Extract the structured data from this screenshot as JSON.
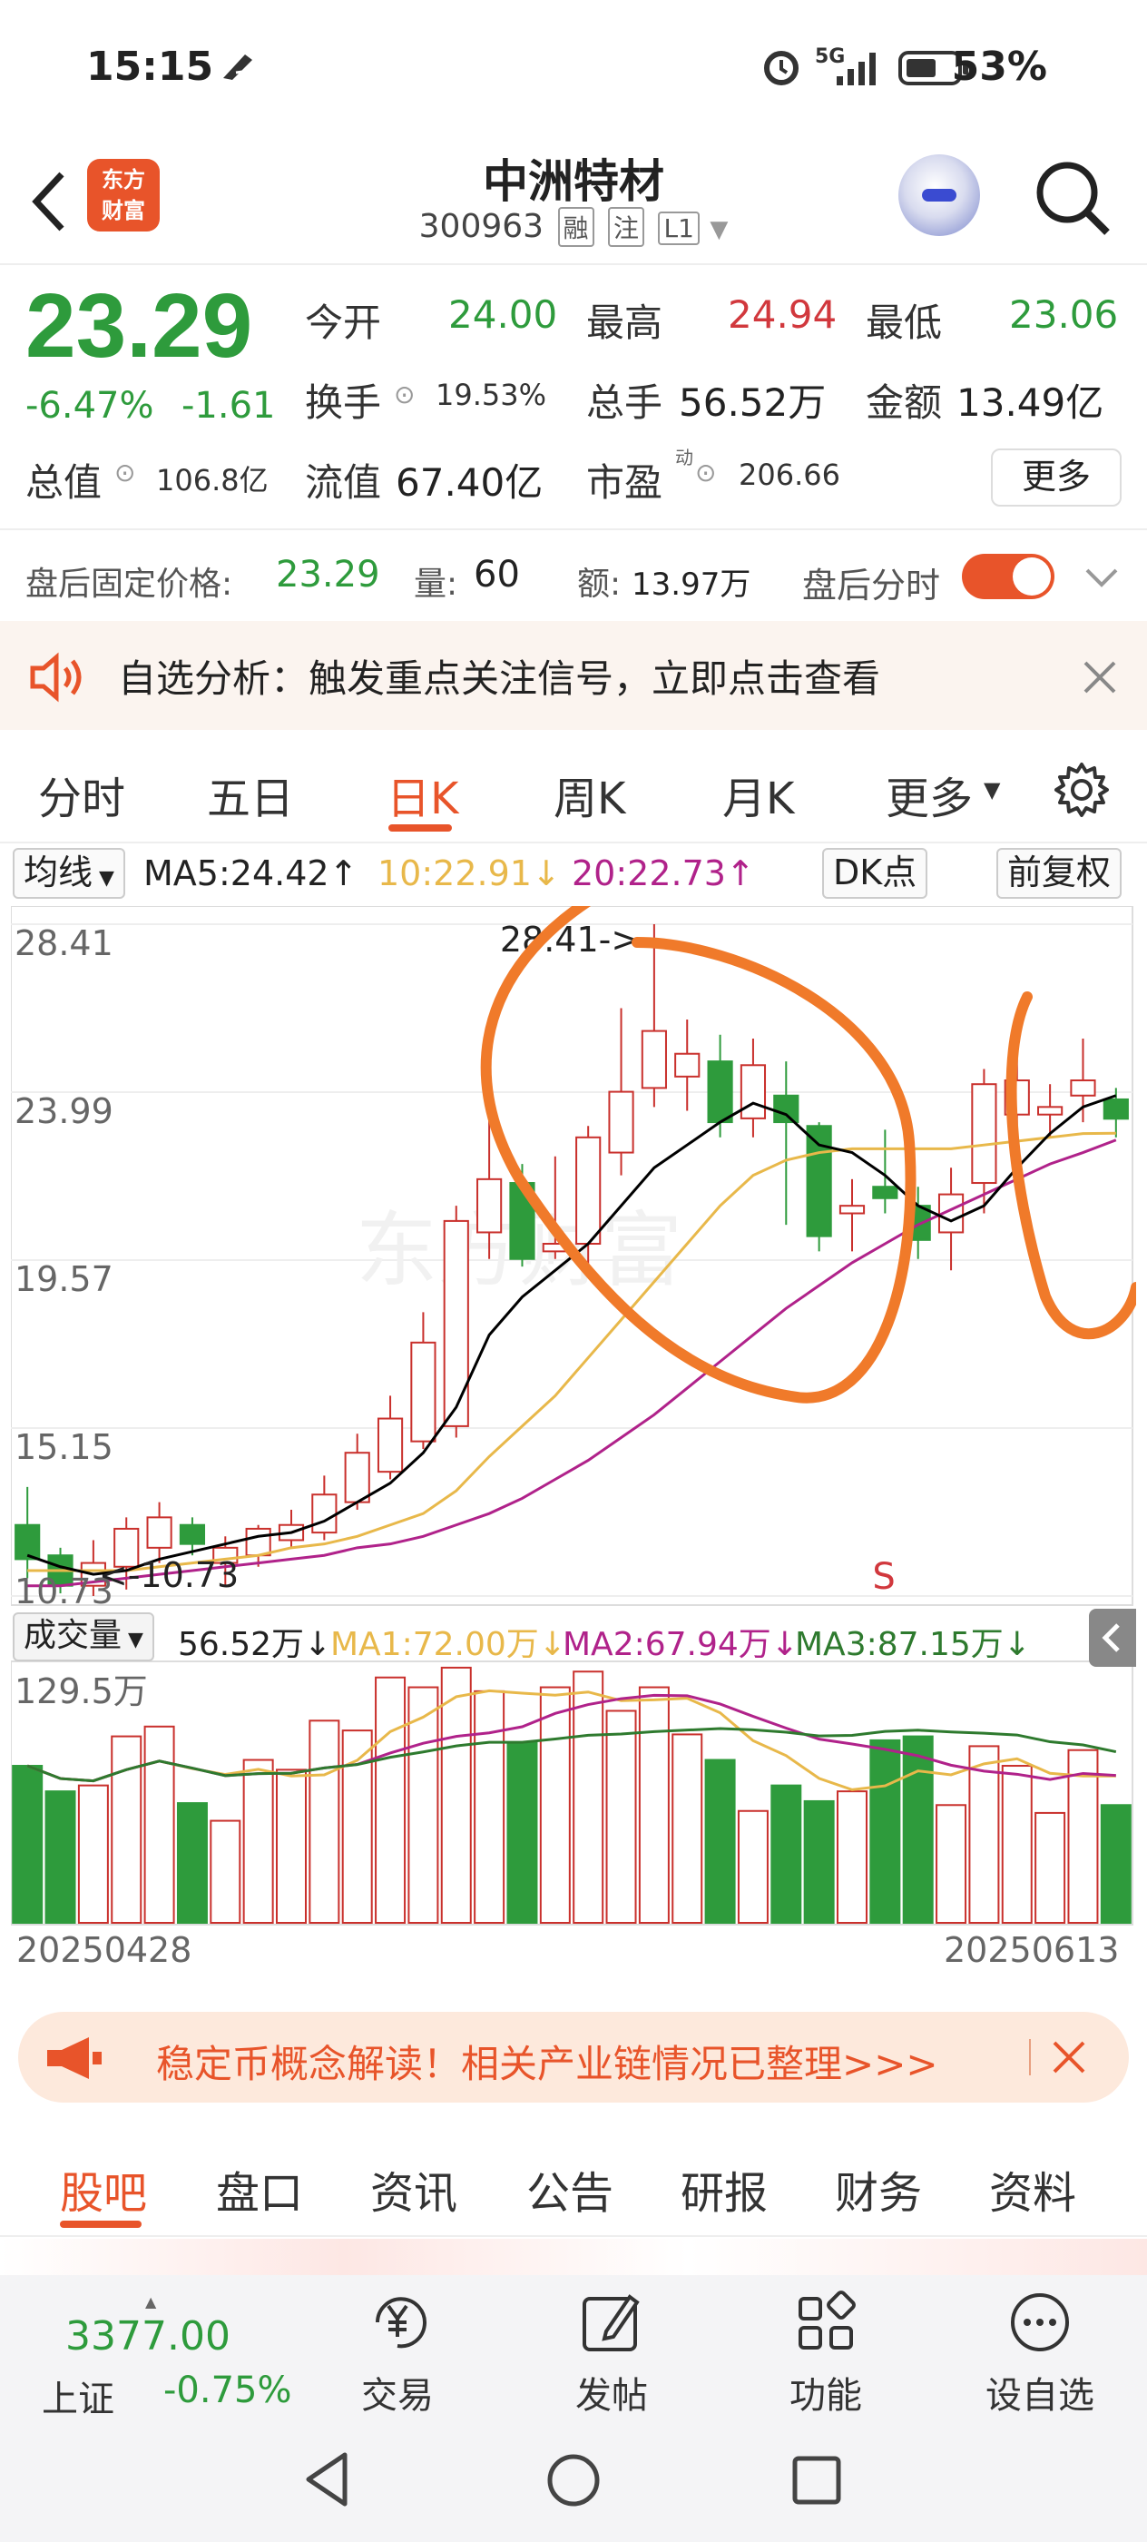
{
  "status_bar": {
    "time": "15:15",
    "network": "5G",
    "battery": "53%"
  },
  "header": {
    "app_logo_line1": "东方",
    "app_logo_line2": "财富",
    "stock_name": "中洲特材",
    "stock_code": "300963",
    "tags": [
      "融",
      "注",
      "L1"
    ]
  },
  "quote": {
    "price": "23.29",
    "change_pct": "-6.47%",
    "change_amt": "-1.61",
    "open_label": "今开",
    "open": "24.00",
    "high_label": "最高",
    "high": "24.94",
    "low_label": "最低",
    "low": "23.06",
    "turnover_label": "换手",
    "turnover": "19.53%",
    "volume_label": "总手",
    "volume": "56.52万",
    "amount_label": "金额",
    "amount": "13.49亿",
    "mcap_label": "总值",
    "mcap": "106.8亿",
    "float_label": "流值",
    "float": "67.40亿",
    "pe_label": "市盈",
    "pe_sup": "动",
    "pe": "206.66",
    "more_label": "更多"
  },
  "after_hours": {
    "price_label": "盘后固定价格:",
    "price": "23.29",
    "vol_label": "量:",
    "vol": "60",
    "amt_label": "额:",
    "amt": "13.97万",
    "toggle_label": "盘后分时"
  },
  "alert": {
    "text": "自选分析：触发重点关注信号，立即点击查看"
  },
  "period_tabs": [
    "分时",
    "五日",
    "日K",
    "周K",
    "月K",
    "更多"
  ],
  "ma_bar": {
    "selector": "均线",
    "ma5": "MA5:24.42↑",
    "ma10": "10:22.91↓",
    "ma20": "20:22.73↑",
    "dk": "DK点",
    "adjust": "前复权"
  },
  "chart_data": {
    "type": "candlestick",
    "price_axis_labels": [
      "28.41",
      "23.99",
      "19.57",
      "15.15",
      "10.73"
    ],
    "ylim": [
      10.73,
      28.41
    ],
    "max_annotation": "28.41->",
    "min_annotation": "<-10.73",
    "signal_mark": "S",
    "watermark": "东方财富",
    "candles": [
      {
        "o": 12.6,
        "h": 13.6,
        "l": 11.2,
        "c": 11.7
      },
      {
        "o": 11.8,
        "h": 12.0,
        "l": 10.8,
        "c": 11.0
      },
      {
        "o": 11.0,
        "h": 12.2,
        "l": 10.73,
        "c": 11.6
      },
      {
        "o": 11.5,
        "h": 12.8,
        "l": 10.9,
        "c": 12.5
      },
      {
        "o": 12.0,
        "h": 13.2,
        "l": 11.6,
        "c": 12.8
      },
      {
        "o": 12.6,
        "h": 12.8,
        "l": 11.8,
        "c": 12.1
      },
      {
        "o": 11.6,
        "h": 12.3,
        "l": 11.0,
        "c": 12.0
      },
      {
        "o": 11.8,
        "h": 12.6,
        "l": 11.5,
        "c": 12.5
      },
      {
        "o": 12.2,
        "h": 13.0,
        "l": 12.0,
        "c": 12.6
      },
      {
        "o": 12.4,
        "h": 13.9,
        "l": 12.2,
        "c": 13.4
      },
      {
        "o": 13.2,
        "h": 15.0,
        "l": 13.0,
        "c": 14.5
      },
      {
        "o": 14.0,
        "h": 16.0,
        "l": 13.8,
        "c": 15.4
      },
      {
        "o": 14.8,
        "h": 18.2,
        "l": 14.6,
        "c": 17.4
      },
      {
        "o": 15.2,
        "h": 21.0,
        "l": 14.9,
        "c": 20.6
      },
      {
        "o": 20.3,
        "h": 24.2,
        "l": 19.6,
        "c": 21.7
      },
      {
        "o": 21.6,
        "h": 22.1,
        "l": 19.4,
        "c": 19.6
      },
      {
        "o": 19.8,
        "h": 22.3,
        "l": 19.6,
        "c": 20.0
      },
      {
        "o": 20.0,
        "h": 23.1,
        "l": 19.4,
        "c": 22.8
      },
      {
        "o": 22.4,
        "h": 26.2,
        "l": 21.8,
        "c": 24.0
      },
      {
        "o": 24.1,
        "h": 28.41,
        "l": 23.6,
        "c": 25.6
      },
      {
        "o": 24.4,
        "h": 25.9,
        "l": 23.5,
        "c": 25.0
      },
      {
        "o": 24.8,
        "h": 25.5,
        "l": 22.8,
        "c": 23.2
      },
      {
        "o": 23.3,
        "h": 25.4,
        "l": 22.8,
        "c": 24.7
      },
      {
        "o": 23.9,
        "h": 24.8,
        "l": 20.5,
        "c": 23.2
      },
      {
        "o": 23.1,
        "h": 23.2,
        "l": 19.8,
        "c": 20.2
      },
      {
        "o": 20.8,
        "h": 21.7,
        "l": 19.8,
        "c": 21.0
      },
      {
        "o": 21.5,
        "h": 23.0,
        "l": 20.8,
        "c": 21.2
      },
      {
        "o": 21.0,
        "h": 21.5,
        "l": 19.6,
        "c": 20.1
      },
      {
        "o": 20.3,
        "h": 22.0,
        "l": 19.3,
        "c": 21.3
      },
      {
        "o": 21.6,
        "h": 24.6,
        "l": 20.8,
        "c": 24.2
      },
      {
        "o": 23.4,
        "h": 24.9,
        "l": 22.6,
        "c": 24.3
      },
      {
        "o": 23.4,
        "h": 24.2,
        "l": 22.8,
        "c": 23.6
      },
      {
        "o": 23.9,
        "h": 25.4,
        "l": 23.2,
        "c": 24.3
      },
      {
        "o": 23.8,
        "h": 24.1,
        "l": 22.8,
        "c": 23.29
      }
    ],
    "ma5": [
      11.8,
      11.5,
      11.3,
      11.4,
      11.7,
      11.9,
      12.1,
      12.3,
      12.4,
      12.7,
      13.2,
      13.7,
      14.5,
      15.7,
      17.6,
      18.6,
      19.3,
      20.0,
      21.0,
      22.0,
      22.6,
      23.2,
      23.7,
      23.4,
      22.6,
      22.4,
      21.8,
      21.0,
      20.6,
      21.0,
      22.0,
      22.9,
      23.6,
      23.9
    ],
    "ma10": [
      11.4,
      11.4,
      11.4,
      11.4,
      11.5,
      11.6,
      11.7,
      11.8,
      12.0,
      12.1,
      12.3,
      12.6,
      12.9,
      13.5,
      14.4,
      15.2,
      16.0,
      17.0,
      18.0,
      19.0,
      20.0,
      21.0,
      21.8,
      22.2,
      22.4,
      22.5,
      22.5,
      22.5,
      22.5,
      22.6,
      22.7,
      22.8,
      22.9,
      22.91
    ],
    "ma20": [
      11.0,
      11.0,
      11.1,
      11.2,
      11.3,
      11.4,
      11.5,
      11.6,
      11.7,
      11.8,
      12.0,
      12.1,
      12.3,
      12.6,
      12.9,
      13.3,
      13.8,
      14.3,
      14.9,
      15.5,
      16.2,
      16.9,
      17.6,
      18.3,
      18.9,
      19.5,
      20.0,
      20.5,
      20.9,
      21.3,
      21.7,
      22.1,
      22.4,
      22.73
    ],
    "volume": {
      "label": "成交量",
      "current": "56.52万↓",
      "ma1": "MA1:72.00万↓",
      "ma2": "MA2:67.94万↓",
      "ma3": "MA3:87.15万↓",
      "max_label": "129.5万",
      "ylim": [
        0,
        129.5
      ],
      "bars": [
        80,
        67,
        70,
        95,
        100,
        61,
        52,
        83,
        78,
        103,
        98,
        125,
        120,
        130,
        118,
        92,
        120,
        128,
        108,
        120,
        96,
        83,
        57,
        70,
        62,
        67,
        93,
        95,
        60,
        90,
        80,
        56,
        88,
        60
      ]
    },
    "x_start": "20250428",
    "x_end": "20250613",
    "colors": {
      "up": "#c9302c",
      "down": "#2e9b3c",
      "ma5": "#000000",
      "ma10": "#e8b84a",
      "ma20": "#b0228a"
    }
  },
  "banner": {
    "text": "稳定币概念解读！相关产业链情况已整理>>>"
  },
  "bottom_tabs": [
    "股吧",
    "盘口",
    "资讯",
    "公告",
    "研报",
    "财务",
    "资料"
  ],
  "bottom_nav": {
    "index_value": "3377.00",
    "index_name": "上证",
    "index_change": "-0.75%",
    "items": [
      "交易",
      "发帖",
      "功能",
      "设自选"
    ]
  },
  "colors": {
    "accent": "#e8542a",
    "up": "#d1383d",
    "down": "#2e9b3c",
    "annotation": "#f07a2a"
  }
}
